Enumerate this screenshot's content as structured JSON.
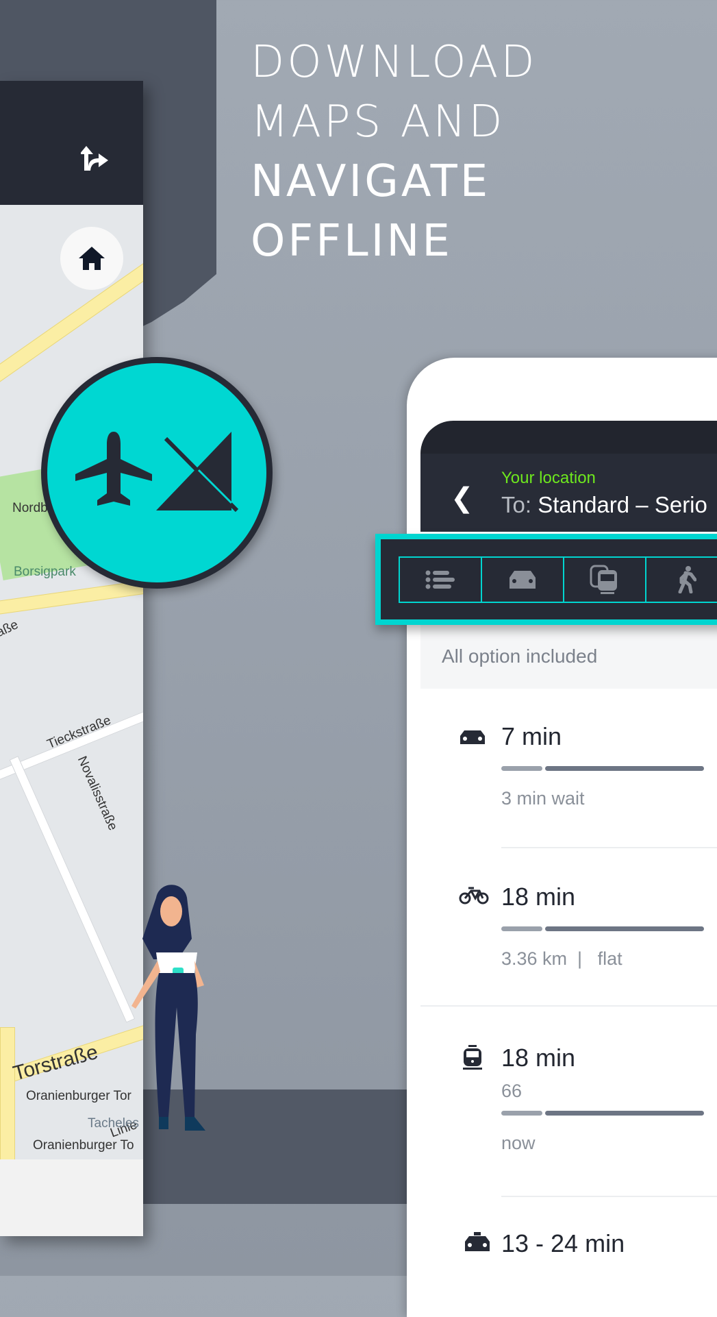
{
  "headline": {
    "line1": "DOWNLOAD",
    "line2": "MAPS AND",
    "line3": "NAVIGATE",
    "line4": "OFFLINE"
  },
  "map": {
    "labels": [
      "Nordb",
      "No",
      "Borsigpark",
      "aße",
      "Tieckstraße",
      "Novalisstraße",
      "Torstraße",
      "Linie",
      "Oranienburger Tor",
      "Tacheles",
      "Oranienburger To"
    ],
    "icons": [
      "directions-icon",
      "home-icon"
    ]
  },
  "badge": {
    "icons": [
      "airplane-icon",
      "no-signal-icon"
    ]
  },
  "route": {
    "from": "Your location",
    "to_prefix": "To:",
    "to": "Standard – Serio",
    "tabs": [
      "list-icon",
      "car-icon",
      "public-transport-icon",
      "walk-icon"
    ],
    "filter": "All option included"
  },
  "options": [
    {
      "icon": "car-icon",
      "title": "7 min",
      "sub": "3 min wait"
    },
    {
      "icon": "bike-icon",
      "title": "18 min",
      "sub": "3.36 km  |   flat"
    },
    {
      "icon": "tram-icon",
      "title": "18 min",
      "line": "66",
      "sub": "now"
    },
    {
      "icon": "taxi-icon",
      "title": "13 - 24 min"
    }
  ],
  "colors": {
    "accent": "#00d5d0",
    "location_green": "#6ee81e",
    "header": "#262a35"
  }
}
